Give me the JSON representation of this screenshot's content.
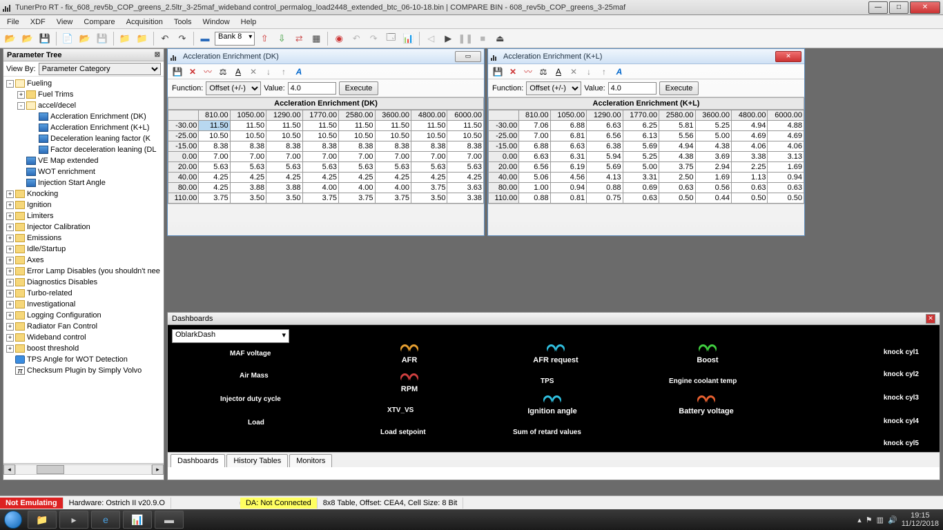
{
  "window": {
    "title": "TunerPro RT - fix_608_rev5b_COP_greens_2.5ltr_3-25maf_wideband control_permalog_load2448_extended_btc_06-10-18.bin | COMPARE BIN - 608_rev5b_COP_greens_3-25maf"
  },
  "menu": [
    "File",
    "XDF",
    "View",
    "Compare",
    "Acquisition",
    "Tools",
    "Window",
    "Help"
  ],
  "toolbar": {
    "bank": "Bank 8"
  },
  "ptree": {
    "title": "Parameter Tree",
    "viewby_label": "View By:",
    "viewby_value": "Parameter Category",
    "nodes": [
      {
        "lvl": 0,
        "ex": "-",
        "icon": "folderopen",
        "label": "Fueling"
      },
      {
        "lvl": 1,
        "ex": "+",
        "icon": "folder",
        "label": "Fuel Trims"
      },
      {
        "lvl": 1,
        "ex": "-",
        "icon": "folderopen",
        "label": "accel/decel"
      },
      {
        "lvl": 2,
        "ex": "",
        "icon": "table",
        "label": "Accleration Enrichment (DK)"
      },
      {
        "lvl": 2,
        "ex": "",
        "icon": "table",
        "label": "Accleration Enrichment (K+L)"
      },
      {
        "lvl": 2,
        "ex": "",
        "icon": "table",
        "label": "Deceleration leaning factor (K"
      },
      {
        "lvl": 2,
        "ex": "",
        "icon": "table",
        "label": "Factor deceleration leaning (DL"
      },
      {
        "lvl": 1,
        "ex": "",
        "icon": "table",
        "label": "VE Map extended"
      },
      {
        "lvl": 1,
        "ex": "",
        "icon": "table",
        "label": "WOT enrichment"
      },
      {
        "lvl": 1,
        "ex": "",
        "icon": "table",
        "label": "Injection Start Angle"
      },
      {
        "lvl": 0,
        "ex": "+",
        "icon": "folder",
        "label": "Knocking"
      },
      {
        "lvl": 0,
        "ex": "+",
        "icon": "folder",
        "label": "Ignition"
      },
      {
        "lvl": 0,
        "ex": "+",
        "icon": "folder",
        "label": "Limiters"
      },
      {
        "lvl": 0,
        "ex": "+",
        "icon": "folder",
        "label": "Injector Calibration"
      },
      {
        "lvl": 0,
        "ex": "+",
        "icon": "folder",
        "label": "Emissions"
      },
      {
        "lvl": 0,
        "ex": "+",
        "icon": "folder",
        "label": "Idle/Startup"
      },
      {
        "lvl": 0,
        "ex": "+",
        "icon": "folder",
        "label": "Axes"
      },
      {
        "lvl": 0,
        "ex": "+",
        "icon": "folder",
        "label": "Error Lamp Disables (you shouldn't nee"
      },
      {
        "lvl": 0,
        "ex": "+",
        "icon": "folder",
        "label": "Diagnostics Disables"
      },
      {
        "lvl": 0,
        "ex": "+",
        "icon": "folder",
        "label": "Turbo-related"
      },
      {
        "lvl": 0,
        "ex": "+",
        "icon": "folder",
        "label": "Investigational"
      },
      {
        "lvl": 0,
        "ex": "+",
        "icon": "folder",
        "label": "Logging Configuration"
      },
      {
        "lvl": 0,
        "ex": "+",
        "icon": "folder",
        "label": "Radiator Fan Control"
      },
      {
        "lvl": 0,
        "ex": "+",
        "icon": "folder",
        "label": "Wideband control"
      },
      {
        "lvl": 0,
        "ex": "+",
        "icon": "folder",
        "label": "boost threshold"
      },
      {
        "lvl": 0,
        "ex": "",
        "icon": "flag",
        "label": "TPS Angle for WOT Detection"
      },
      {
        "lvl": 0,
        "ex": "",
        "icon": "func",
        "label": "Checksum Plugin by Simply Volvo"
      }
    ]
  },
  "tables": {
    "func_label": "Function:",
    "func_value": "Offset (+/-)",
    "val_label": "Value:",
    "val_value": "4.0",
    "exec": "Execute",
    "cols": [
      "810.00",
      "1050.00",
      "1290.00",
      "1770.00",
      "2580.00",
      "3600.00",
      "4800.00",
      "6000.00"
    ],
    "rows": [
      "-30.00",
      "-25.00",
      "-15.00",
      "0.00",
      "20.00",
      "40.00",
      "80.00",
      "110.00"
    ],
    "dk": {
      "title": "Accleration Enrichment (DK)",
      "data": [
        [
          "11.50",
          "11.50",
          "11.50",
          "11.50",
          "11.50",
          "11.50",
          "11.50",
          "11.50"
        ],
        [
          "10.50",
          "10.50",
          "10.50",
          "10.50",
          "10.50",
          "10.50",
          "10.50",
          "10.50"
        ],
        [
          "8.38",
          "8.38",
          "8.38",
          "8.38",
          "8.38",
          "8.38",
          "8.38",
          "8.38"
        ],
        [
          "7.00",
          "7.00",
          "7.00",
          "7.00",
          "7.00",
          "7.00",
          "7.00",
          "7.00"
        ],
        [
          "5.63",
          "5.63",
          "5.63",
          "5.63",
          "5.63",
          "5.63",
          "5.63",
          "5.63"
        ],
        [
          "4.25",
          "4.25",
          "4.25",
          "4.25",
          "4.25",
          "4.25",
          "4.25",
          "4.25"
        ],
        [
          "4.25",
          "3.88",
          "3.88",
          "4.00",
          "4.00",
          "4.00",
          "3.75",
          "3.63"
        ],
        [
          "3.75",
          "3.50",
          "3.50",
          "3.75",
          "3.75",
          "3.75",
          "3.50",
          "3.38"
        ]
      ]
    },
    "kl": {
      "title": "Accleration Enrichment (K+L)",
      "data": [
        [
          "7.06",
          "6.88",
          "6.63",
          "6.25",
          "5.81",
          "5.25",
          "4.94",
          "4.88"
        ],
        [
          "7.00",
          "6.81",
          "6.56",
          "6.13",
          "5.56",
          "5.00",
          "4.69",
          "4.69"
        ],
        [
          "6.88",
          "6.63",
          "6.38",
          "5.69",
          "4.94",
          "4.38",
          "4.06",
          "4.06"
        ],
        [
          "6.63",
          "6.31",
          "5.94",
          "5.25",
          "4.38",
          "3.69",
          "3.38",
          "3.13"
        ],
        [
          "6.56",
          "6.19",
          "5.69",
          "5.00",
          "3.75",
          "2.94",
          "2.25",
          "1.69"
        ],
        [
          "5.06",
          "4.56",
          "4.13",
          "3.31",
          "2.50",
          "1.69",
          "1.13",
          "0.94"
        ],
        [
          "1.00",
          "0.94",
          "0.88",
          "0.69",
          "0.63",
          "0.56",
          "0.63",
          "0.63"
        ],
        [
          "0.88",
          "0.81",
          "0.75",
          "0.63",
          "0.50",
          "0.44",
          "0.50",
          "0.50"
        ]
      ]
    }
  },
  "dash": {
    "title": "Dashboards",
    "dd": "OblarkDash",
    "tabs": [
      "Dashboards",
      "History Tables",
      "Monitors"
    ],
    "labels": {
      "maf": "MAF voltage",
      "airmass": "Air Mass",
      "inj": "Injector duty cycle",
      "load": "Load",
      "afr": "AFR",
      "rpm": "RPM",
      "xtv": "XTV_VS",
      "loadsp": "Load setpoint",
      "afrreq": "AFR request",
      "tps": "TPS",
      "ign": "Ignition angle",
      "retard": "Sum of retard values",
      "boost": "Boost",
      "ect": "Engine coolant temp",
      "batt": "Battery voltage",
      "k1": "knock cyl1",
      "k2": "knock cyl2",
      "k3": "knock cyl3",
      "k4": "knock cyl4",
      "k5": "knock cyl5"
    }
  },
  "status": {
    "emu": "Not Emulating",
    "hw": "Hardware: Ostrich II v20.9.O",
    "da": "DA: Not Connected",
    "info": "8x8 Table, Offset: CEA4,   Cell Size: 8 Bit"
  },
  "clock": {
    "time": "19:15",
    "date": "11/12/2018"
  }
}
